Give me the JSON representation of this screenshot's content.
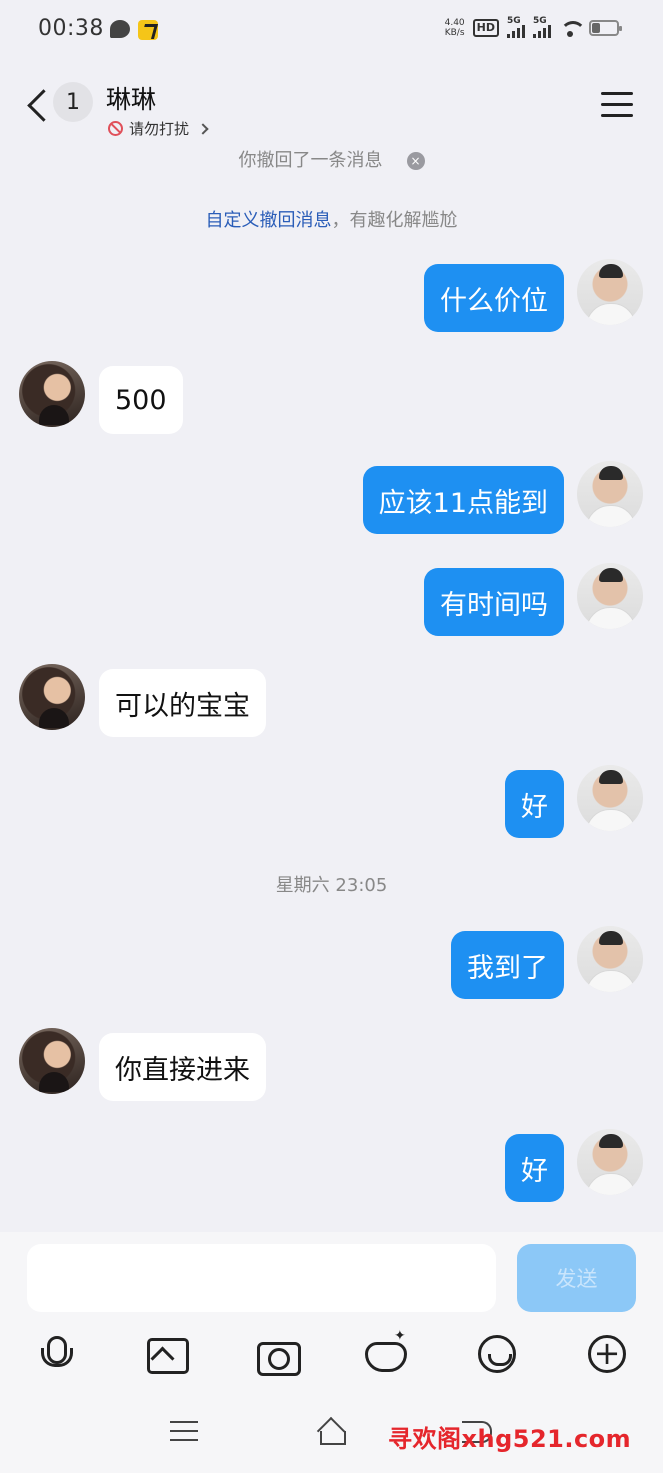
{
  "status_bar": {
    "time": "00:38",
    "net_speed_value": "4.40",
    "net_speed_unit": "KB/s",
    "hd_label": "HD",
    "signal_1_label": "5G",
    "signal_2_label": "5G"
  },
  "header": {
    "unread_count": "1",
    "contact_name": "琳琳",
    "status_text": "请勿打扰"
  },
  "system": {
    "recall_notice": "你撤回了一条消息",
    "recall_close": "×",
    "tip_link": "自定义撤回消息",
    "tip_text": "，有趣化解尴尬",
    "timestamp": "星期六 23:05"
  },
  "messages": [
    {
      "from": "me",
      "text": "什么价位"
    },
    {
      "from": "her",
      "text": "500"
    },
    {
      "from": "me",
      "text": "应该11点能到"
    },
    {
      "from": "me",
      "text": "有时间吗"
    },
    {
      "from": "her",
      "text": "可以的宝宝"
    },
    {
      "from": "me",
      "text": "好"
    },
    {
      "from": "me",
      "text": "我到了"
    },
    {
      "from": "her",
      "text": "你直接进来"
    },
    {
      "from": "me",
      "text": "好"
    }
  ],
  "composer": {
    "input_value": "",
    "send_label": "发送"
  },
  "toolbar_icons": [
    "microphone-icon",
    "image-icon",
    "camera-icon",
    "mask-icon",
    "emoji-icon",
    "plus-icon"
  ],
  "watermark": "寻欢阁xhg521.com",
  "colors": {
    "outgoing_bubble": "#1e90f2",
    "incoming_bubble": "#ffffff",
    "send_button": "#8cc8f7",
    "link": "#2a5db8",
    "watermark": "#e5262c"
  }
}
